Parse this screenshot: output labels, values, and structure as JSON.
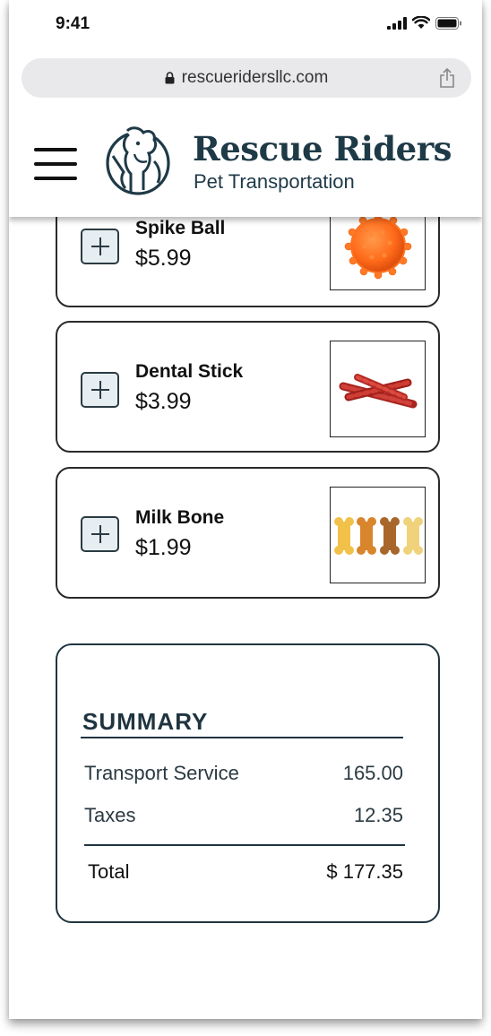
{
  "status_bar": {
    "time": "9:41"
  },
  "browser": {
    "url": "rescueridersllc.com"
  },
  "header": {
    "brand_name": "Rescue Riders",
    "brand_tagline": "Pet Transportation"
  },
  "products": [
    {
      "name": "Spike Ball",
      "price": "$5.99",
      "image": "orange-spike-ball"
    },
    {
      "name": "Dental Stick",
      "price": "$3.99",
      "image": "red-dental-sticks"
    },
    {
      "name": "Milk Bone",
      "price": "$1.99",
      "image": "milk-bone-biscuits"
    }
  ],
  "summary": {
    "title": "SUMMARY",
    "rows": [
      {
        "label": "Transport Service",
        "value": "165.00"
      },
      {
        "label": "Taxes",
        "value": "12.35"
      }
    ],
    "total": {
      "label": "Total",
      "value": "$ 177.35"
    }
  },
  "colors": {
    "brand": "#1f3a47",
    "button_fill": "#e6eef1",
    "spike_ball": "#ff6a1a",
    "dental_stick": "#c0322c"
  }
}
